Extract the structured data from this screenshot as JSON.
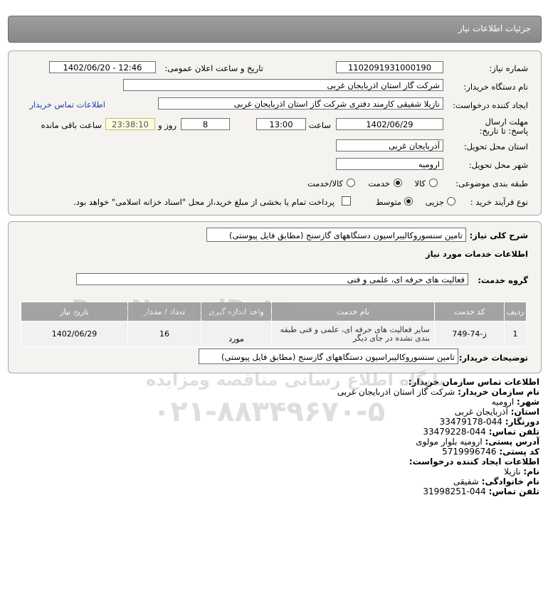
{
  "header": {
    "title": "جزئیات اطلاعات نیاز"
  },
  "info": {
    "need_number_label": "شماره نیاز:",
    "need_number": "1102091931000190",
    "announce_label": "تاریخ و ساعت اعلان عمومی:",
    "announce_value": "1402/06/20 - 12:46",
    "buyer_label": "نام دستگاه خریدار:",
    "buyer_value": "شرکت گاز استان اذربایجان غربی",
    "creator_label": "ایجاد کننده درخواست:",
    "creator_value": "نازیلا شفیقی کارمند دفتری شرکت گاز استان اذربایجان غربی",
    "contact_link": "اطلاعات تماس خریدار",
    "deadline_label": "مهلت ارسال پاسخ: تا تاریخ:",
    "deadline_date": "1402/06/29",
    "time_label": "ساعت",
    "deadline_time": "13:00",
    "days_value": "8",
    "days_label": "روز و",
    "remaining_time": "23:38:10",
    "remaining_label": "ساعت باقی مانده",
    "province_label": "استان محل تحویل:",
    "province_value": "آذربایجان غربی",
    "city_label": "شهر محل تحویل:",
    "city_value": "ارومیه",
    "category_label": "طبقه بندی موضوعی:",
    "category_options": [
      "کالا",
      "خدمت",
      "کالا/خدمت"
    ],
    "category_selected": "خدمت",
    "process_label": "نوع فرآیند خرید :",
    "process_options": [
      "جزیی",
      "متوسط"
    ],
    "process_selected": "متوسط",
    "payment_note": "پرداخت تمام یا بخشی از مبلغ خرید،از محل \"اسناد خزانه اسلامی\" خواهد بود."
  },
  "summary": {
    "desc_label": "شرح کلی نیاز:",
    "desc_value": "تامین سنسوروکالیبراسیون دستگاههای گازسنج (مطابق فایل پیوستی)",
    "services_title": "اطلاعات خدمات مورد نیاز",
    "group_label": "گروه خدمت:",
    "group_value": "فعالیت های حرفه ای، علمی و فنی",
    "table_headers": [
      "ردیف",
      "کد خدمت",
      "نام خدمت",
      "واحد اندازه گیری",
      "تعداد / مقدار",
      "تاریخ نیاز"
    ],
    "rows": [
      {
        "index": "1",
        "code": "ز-74-749",
        "name": "سایر فعالیت های حرفه ای، علمی و فنی طبقه بندی نشده در جای دیگر",
        "unit": "مورد",
        "qty": "16",
        "date": "1402/06/29"
      }
    ],
    "buyer_notes_label": "توضیحات خریدار:",
    "buyer_notes_value": "تامین سنسوروکالیبراسیون دستگاههای گازسنج (مطابق فایل پیوستی)"
  },
  "contact": {
    "title": "اطلاعات تماس سازمان خریدار:",
    "org_label": "نام سازمان خریدار:",
    "org_value": "شرکت گاز استان اذربایجان غربی",
    "city_label": "شهر:",
    "city_value": "ارومیه",
    "province_label": "استان:",
    "province_value": "آذربایجان غربی",
    "fax_label": "دورنگار:",
    "fax_value": "044-33479178",
    "phone_label": "تلفن تماس:",
    "phone_value": "044-33479228",
    "address_label": "آدرس پستی:",
    "address_value": "ارومیه بلوار مولوی",
    "postal_label": "کد پستی:",
    "postal_value": "5719996746",
    "creator_title": "اطلاعات ایجاد کننده درخواست:",
    "first_name_label": "نام:",
    "first_name_value": "نازیلا",
    "last_name_label": "نام خانوادگی:",
    "last_name_value": "شفیقی",
    "creator_phone_label": "تلفن تماس:",
    "creator_phone_value": "044-31998251"
  },
  "watermark": {
    "brand": "ParsNamadData",
    "slogan": "پایگاه اطلاع رسانی مناقصه ومزایده",
    "phone": "۰۲۱-۸۸۳۴۹۶۷۰-۵"
  }
}
